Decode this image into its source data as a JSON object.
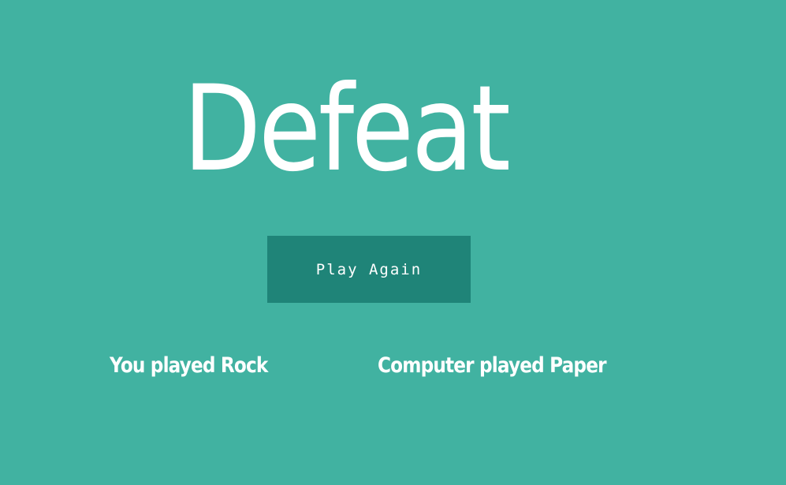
{
  "game": {
    "result_title": "Defeat",
    "play_again_label": "Play Again",
    "player_move_text": "You played Rock",
    "computer_move_text": "Computer played Paper"
  },
  "colors": {
    "background": "#41b2a1",
    "button_background": "#1f8478",
    "text": "#ffffff"
  }
}
